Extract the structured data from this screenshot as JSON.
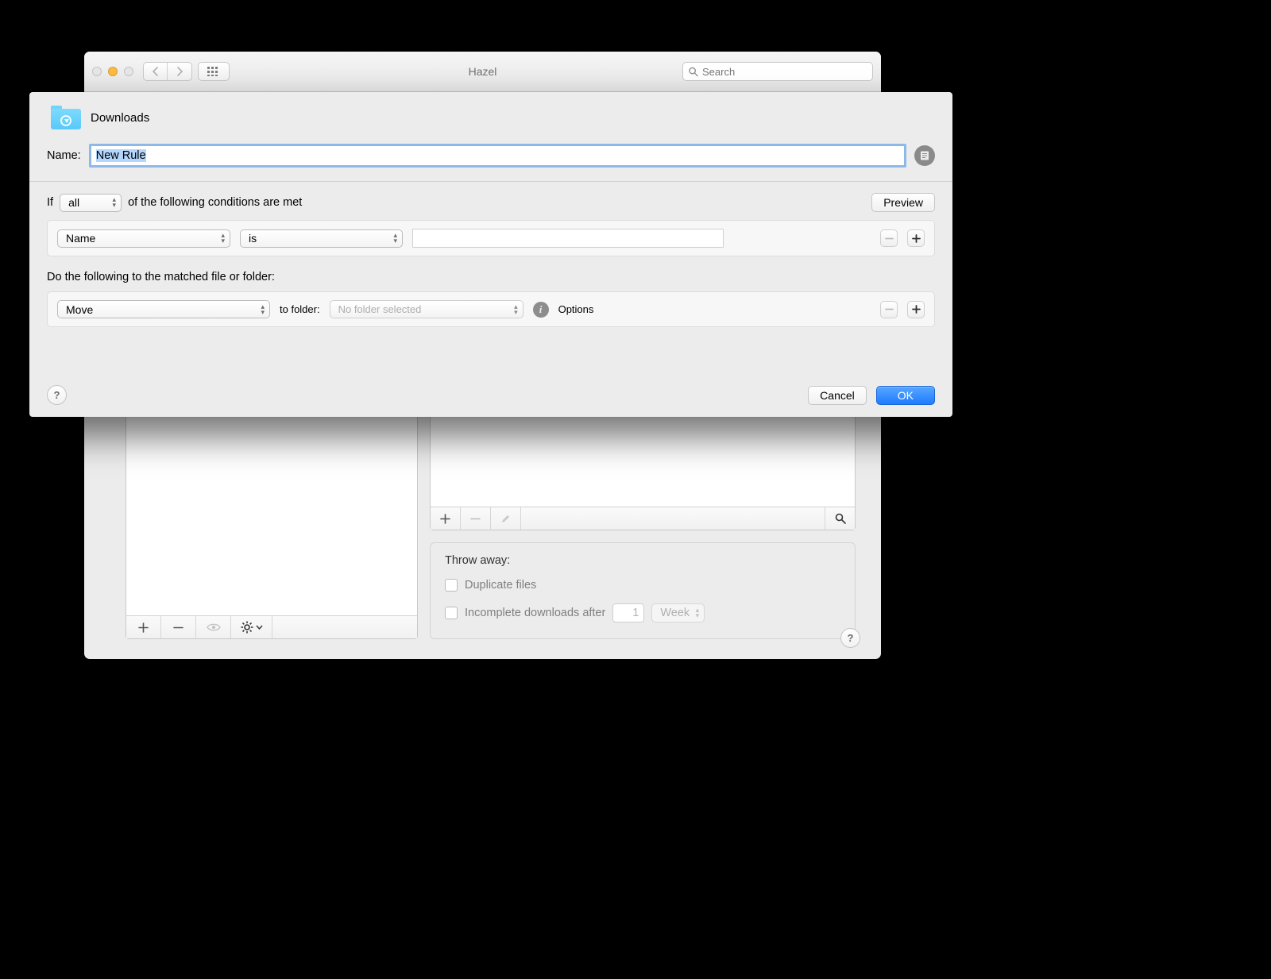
{
  "window": {
    "title": "Hazel",
    "search_placeholder": "Search"
  },
  "sheet": {
    "folder_name": "Downloads",
    "name_label": "Name:",
    "name_value": "New Rule",
    "if_prefix": "If",
    "if_scope": "all",
    "if_suffix": "of the following conditions are met",
    "preview_label": "Preview",
    "condition": {
      "attribute": "Name",
      "operator": "is",
      "value": ""
    },
    "actions_label": "Do the following to the matched file or folder:",
    "action": {
      "verb": "Move",
      "to_label": "to folder:",
      "folder": "No folder selected",
      "options_label": "Options"
    },
    "cancel_label": "Cancel",
    "ok_label": "OK"
  },
  "throw_away": {
    "title": "Throw away:",
    "duplicate_label": "Duplicate files",
    "incomplete_label": "Incomplete downloads after",
    "incomplete_value": "1",
    "incomplete_unit": "Week"
  }
}
